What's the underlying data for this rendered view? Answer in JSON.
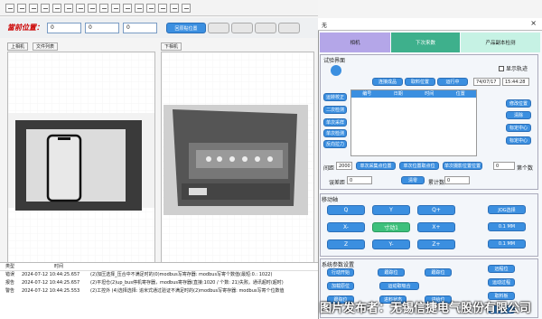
{
  "position": {
    "label": "當前位置：",
    "x": "0",
    "y": "0",
    "z": "0",
    "stop_btn": "回原點位置"
  },
  "tabs_left": [
    "上相机",
    "文件列表"
  ],
  "tab_right": "下相机",
  "log": {
    "headers": [
      "类型",
      "时间",
      ""
    ],
    "rows": [
      {
        "type": "错误",
        "time": "2024-07-12 10:44:25.657",
        "msg": "(2)加压选择_压合中不满足时的(0)modbus写寄存器: modbus写寄个数值(最短:0.: 1022)"
      },
      {
        "type": "报告",
        "time": "2024-07-12 10:44:25.657",
        "msg": "(2)平坦仓(2)up_bus停机寄存器，modbus寄存器(直接:1020 / 个数: 21)失败。通讯超时(超时)"
      },
      {
        "type": "警告",
        "time": "2024-07-12 10:44:25.553",
        "msg": "(2)工控外 (4)选择选择: 追米式通过验证不满足时的(2)modbus写寄存器: modbus写寄个位数值"
      }
    ]
  },
  "right": {
    "title": "无",
    "tabs": [
      "相机",
      "下次来数",
      "产品副本检测"
    ],
    "calib_title": "试验界面",
    "connect_btns": [
      "连接成品",
      "取料位置",
      "运行中"
    ],
    "date": "74/07/17",
    "time": "15:44:28",
    "show_path": "显示轨迹",
    "left_btns": [
      "运转校正",
      "二次检测",
      "单次采样",
      "单次检测",
      "反向拉力"
    ],
    "table_headers": [
      "编号",
      "日期",
      "时间",
      "位置"
    ],
    "right_btns": [
      "修改位置",
      "清除",
      "标定中心",
      "标定中心"
    ],
    "pitch_label": "间距",
    "pitch_value": "2000",
    "mid_btns": [
      "单次采集点位置",
      "单次位置取点位",
      "单次摄影位置位置"
    ],
    "count_label": "第个数",
    "count_value": "0",
    "err_label": "误差距",
    "err_value": "0",
    "clear_btn": "清零",
    "total_label": "累计数",
    "total_value": "0"
  },
  "motion": {
    "title": "移动轴",
    "axes": [
      "Q",
      "Y",
      "Q+",
      "X-",
      "寸动1",
      "X+",
      "Z",
      "Y-",
      "Z+"
    ],
    "side": [
      "JOG选择",
      "0.1 MM",
      "0.1 MM"
    ]
  },
  "bottom": {
    "title": "系统参数设置",
    "btns": [
      "行动开始",
      "跟踪位",
      "跟踪位",
      "远程位",
      "加载原位",
      "运动取吸合",
      "运动过程",
      "跟踪位",
      "进料状态",
      "进给位",
      "取料板",
      "复位"
    ]
  },
  "watermark": "图片发布者：无锡信捷电气股份有限公司"
}
